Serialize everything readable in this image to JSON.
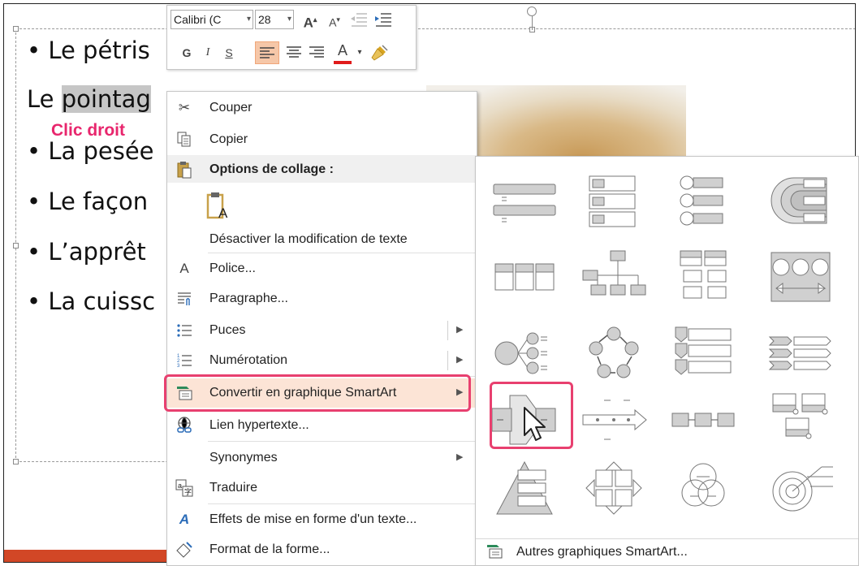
{
  "slide": {
    "bullets": [
      {
        "text": "• Le pétris"
      },
      {
        "prefix": "Le ",
        "selected": "pointag"
      },
      {
        "text": "• La pesée"
      },
      {
        "text": "• Le façon"
      },
      {
        "text": "• L’apprêt"
      },
      {
        "text": "• La cuissc"
      }
    ],
    "annotation": "Clic droit",
    "colors": {
      "annotation": "#e8266d",
      "highlight_border": "#e8406f",
      "footer_bar": "#d24726"
    }
  },
  "minibar": {
    "font": "Calibri (C",
    "size": "28",
    "grow_font": "A",
    "shrink_font": "A",
    "bold": "G",
    "italic": "I",
    "underline": "S",
    "font_color": "A"
  },
  "context_menu": {
    "items": [
      {
        "label": "Couper",
        "icon": "scissors-icon"
      },
      {
        "label": "Copier",
        "icon": "copy-icon"
      },
      {
        "label": "Options de collage :",
        "icon": "paste-icon"
      },
      {
        "label": "Désactiver la modification de texte"
      },
      {
        "label": "Police...",
        "icon": "font-icon"
      },
      {
        "label": "Paragraphe...",
        "icon": "paragraph-icon"
      },
      {
        "label": "Puces",
        "icon": "bullets-icon"
      },
      {
        "label": "Numérotation",
        "icon": "numbering-icon"
      },
      {
        "label": "Convertir en graphique SmartArt",
        "icon": "smartart-icon"
      },
      {
        "label": "Lien hypertexte...",
        "icon": "hyperlink-icon"
      },
      {
        "label": "Synonymes"
      },
      {
        "label": "Traduire",
        "icon": "translate-icon"
      },
      {
        "label": "Effets de mise en forme d'un texte...",
        "icon": "text-effects-icon"
      },
      {
        "label": "Format de la forme...",
        "icon": "format-shape-icon"
      }
    ],
    "paste_option_letter": "A"
  },
  "smartart_submenu": {
    "footer_label": "Autres graphiques SmartArt..."
  }
}
